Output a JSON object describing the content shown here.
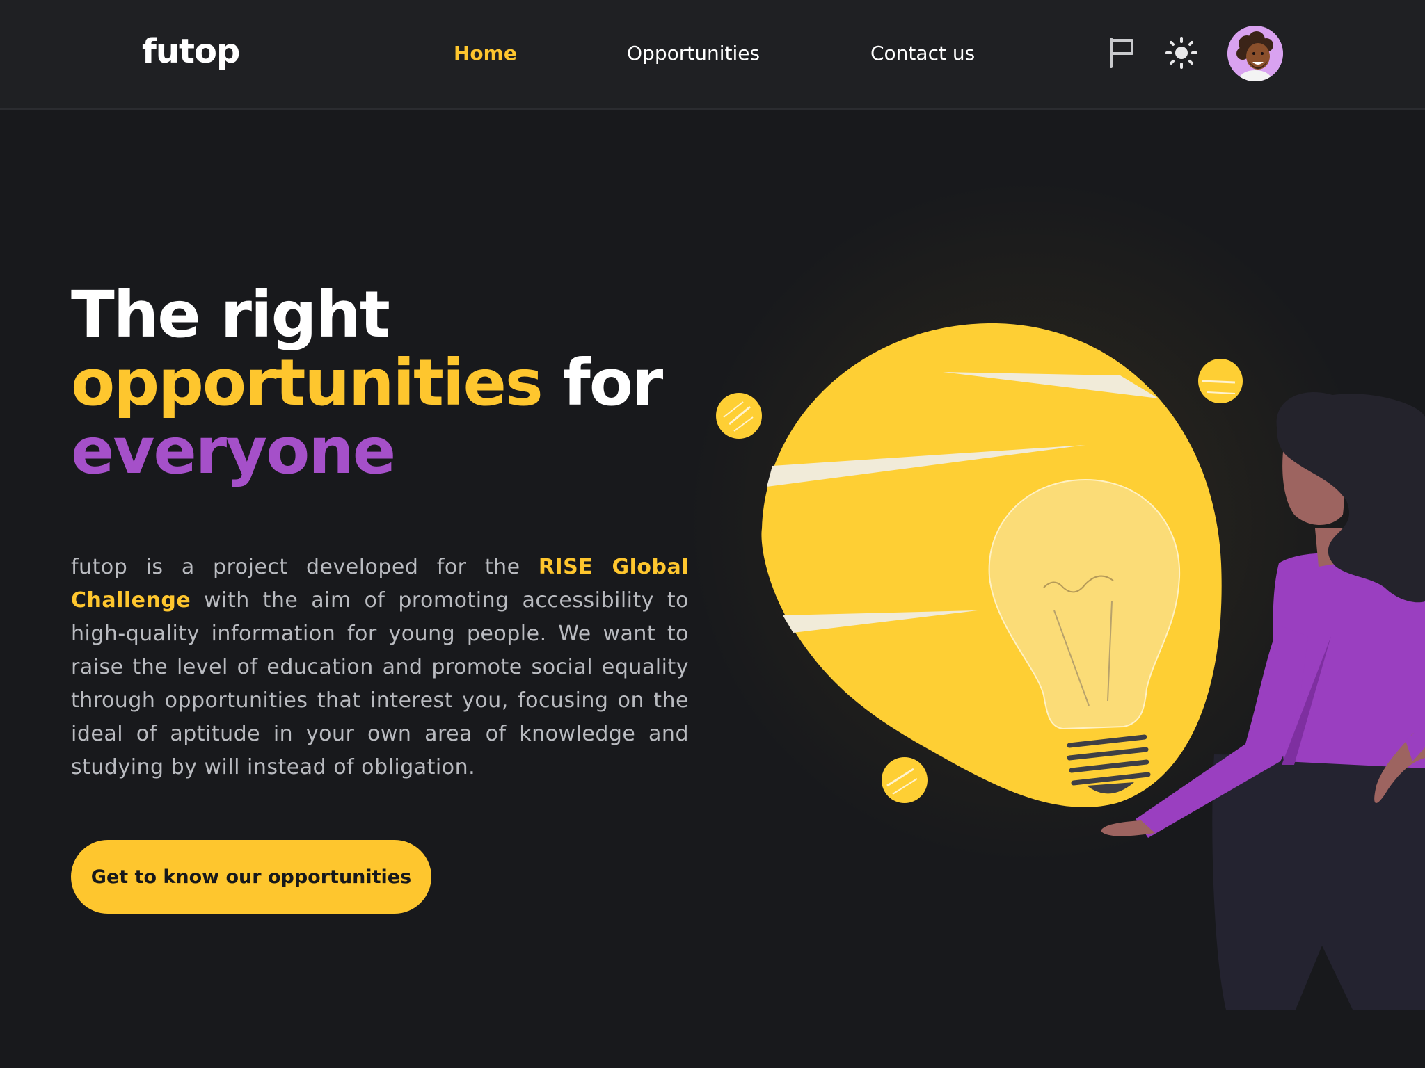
{
  "nav": {
    "logo": "futop",
    "links": [
      "Home",
      "Opportunities",
      "Contact us"
    ],
    "active_link": "Home",
    "icons": [
      "flag-icon",
      "sun-icon"
    ],
    "avatar_icon": "avatar-icon"
  },
  "hero": {
    "title_line1": "The right",
    "title_line2_highlight": "opportunities",
    "title_line2_rest": "for",
    "title_line3": "everyone",
    "desc_part1": "futop is a project developed for the ",
    "desc_highlight": "RISE Global Challenge",
    "desc_part2": " with the aim of promoting accessibility to high-quality information for young people. We want to raise the level of education and promote social equality through opportunities that interest you, focusing on the ideal of aptitude in your own area of knowledge and studying by will instead of obligation.",
    "cta_label": "Get to know our opportunities"
  },
  "colors": {
    "accent_yellow": "#fec62e",
    "accent_purple": "#a550c9",
    "background": "#18191c",
    "navbar": "#1f2023"
  }
}
